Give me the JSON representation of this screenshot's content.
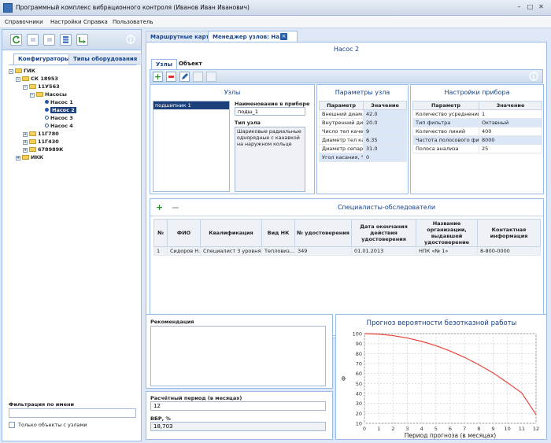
{
  "window": {
    "title": "Программный комплекс вибрационного контроля (Иванов Иван Иванович)",
    "min": "–",
    "max": "□",
    "close": "✕"
  },
  "menu": [
    "Справочники",
    "Настройки",
    "Справка",
    "Пользователь"
  ],
  "left": {
    "tabs": [
      "Конфигураторы",
      "Типы оборудования"
    ],
    "tree": [
      {
        "label": "ГИК"
      },
      {
        "label": "СК 18953"
      },
      {
        "label": "11У563"
      },
      {
        "label": "Насосы"
      },
      {
        "label": "Насос 1"
      },
      {
        "label": "Насос 2"
      },
      {
        "label": "Насос 3"
      },
      {
        "label": "Насос 4"
      },
      {
        "label": "11Г780"
      },
      {
        "label": "11Г430"
      },
      {
        "label": "678989К"
      },
      {
        "label": "ИКК"
      }
    ],
    "filter_label": "Фильтрация по имени",
    "filter_value": "",
    "only_with_nodes": "Только объекты с узлами"
  },
  "tabs": [
    {
      "label": "Маршрутные карты"
    },
    {
      "label": "Менеджер узлов: На..."
    }
  ],
  "object_title": "Насос 2",
  "subtabs": [
    "Узлы",
    "Объект"
  ],
  "nodes": {
    "title": "Узлы",
    "list": [
      "подшипник 1"
    ],
    "name_label": "Наименование в приборе",
    "name_value": "подш_1",
    "type_label": "Тип узла",
    "type_value": "Шариковые радиальные однорядные с канавкой на наружном кольце"
  },
  "node_params": {
    "title": "Параметры узла",
    "headers": [
      "Параметр",
      "Значение"
    ],
    "rows": [
      [
        "Внешний диам...",
        "42.0"
      ],
      [
        "Внутренний ди...",
        "20.0"
      ],
      [
        "Число тел каче...",
        "9"
      ],
      [
        "Диаметр тел ка...",
        "6.35"
      ],
      [
        "Диаметр сепар...",
        "31.0"
      ],
      [
        "Угол касания, °",
        "0"
      ]
    ]
  },
  "device_settings": {
    "title": "Настройки прибора",
    "headers": [
      "Параметр",
      "Значение"
    ],
    "rows": [
      [
        "Количество усреднений",
        "1"
      ],
      [
        "Тип фильтра",
        "Октавный"
      ],
      [
        "Количество линий",
        "400"
      ],
      [
        "Частота полосового фи...",
        "8000"
      ],
      [
        "Полоса анализа",
        "25"
      ]
    ]
  },
  "specialists": {
    "title": "Специалисты-обследователи",
    "headers": [
      "№",
      "ФИО",
      "Квалификация",
      "Вид НК",
      "№ удостоверения",
      "Дата окончания действия удостоверения",
      "Название организации, выдавшей удостоверение",
      "Контактная информация"
    ],
    "rows": [
      [
        "1",
        "Сидоров Н...",
        "Специалист 3 уровня",
        "Тепловиз...",
        "349",
        "01.01.2013",
        "НПК «№ 1»",
        "8-800-0000"
      ]
    ]
  },
  "recommendation_label": "Рекомендация",
  "period_label": "Расчётный период (в месяцах)",
  "period_value": "12",
  "vbr_label": "ВБР, %",
  "vbr_value": "18,703",
  "chart_data": {
    "type": "line",
    "title": "Прогноз вероятности безотказной работы",
    "xlabel": "Период прогноза (в месяцах)",
    "ylabel": "Ф",
    "x": [
      0,
      1,
      2,
      3,
      4,
      5,
      6,
      7,
      8,
      9,
      10,
      11,
      12
    ],
    "series": [
      {
        "values": [
          100,
          99.5,
          98,
          95.6,
          92.2,
          87.9,
          82.5,
          76.2,
          68.8,
          60.5,
          50.8,
          40.5,
          18.7
        ]
      }
    ],
    "xlim": [
      0,
      12
    ],
    "ylim": [
      10,
      100
    ],
    "yticks": [
      10,
      20,
      30,
      40,
      50,
      60,
      70,
      80,
      90,
      100
    ],
    "line_color": "#e8443a",
    "grid": true
  }
}
